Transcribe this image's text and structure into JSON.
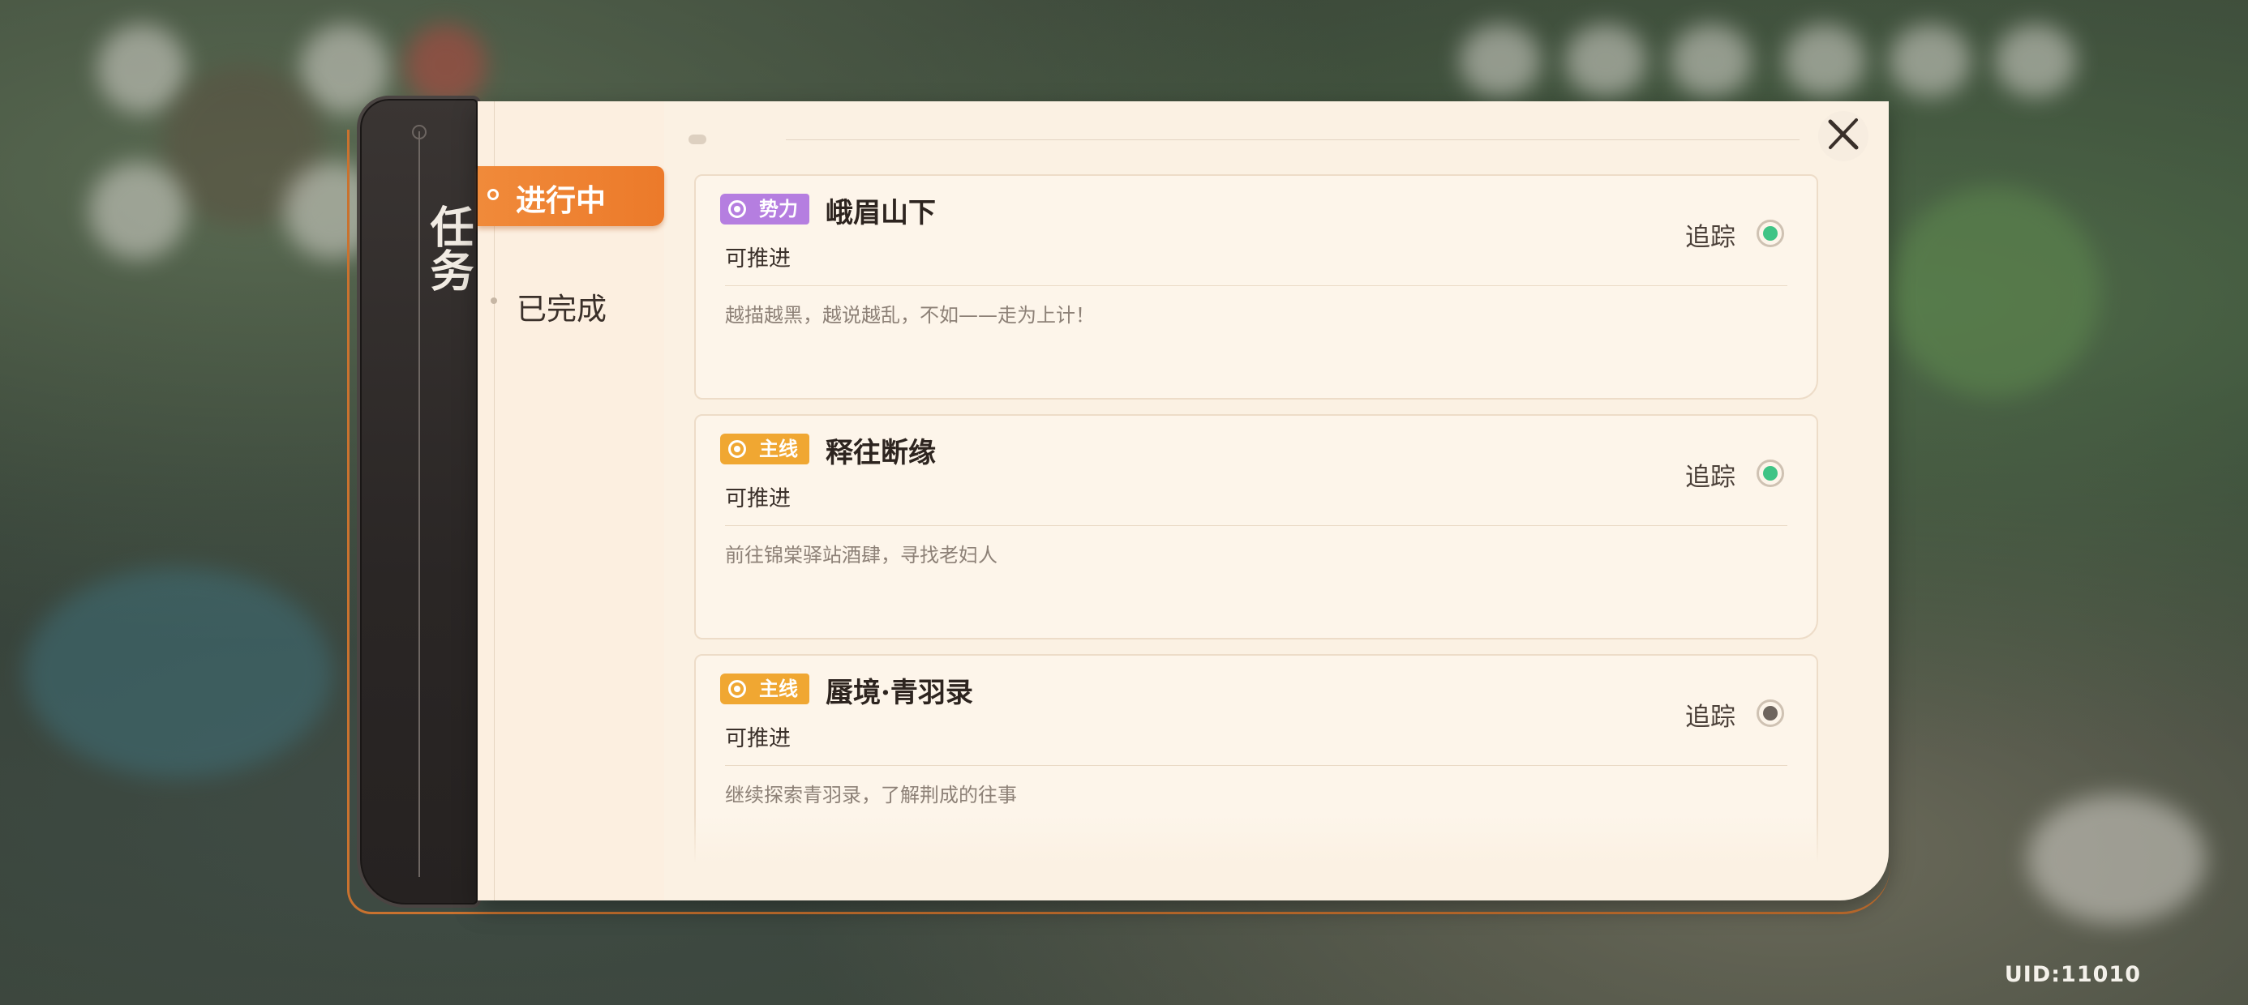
{
  "background": {
    "uid": "UID:11010"
  },
  "sidebar": {
    "title": "任务"
  },
  "tabs": [
    {
      "label": "进行中",
      "active": true
    },
    {
      "label": "已完成",
      "active": false
    }
  ],
  "quests": [
    {
      "tag": "势力",
      "tag_color": "#b57ee0",
      "title": "峨眉山下",
      "status": "可推进",
      "description": "越描越黑，越说越乱，不如——走为上计！",
      "track_label": "追踪",
      "tracked": true,
      "track_color": "#3fc485"
    },
    {
      "tag": "主线",
      "tag_color": "#f0a732",
      "title": "释往断缘",
      "status": "可推进",
      "description": "前往锦棠驿站酒肆，寻找老妇人",
      "track_label": "追踪",
      "tracked": true,
      "track_color": "#3fc485"
    },
    {
      "tag": "主线",
      "tag_color": "#f0a732",
      "title": "蜃境·青羽录",
      "status": "可推进",
      "description": "继续探索青羽录，了解荆成的往事",
      "track_label": "追踪",
      "tracked": false,
      "track_color": "#6e655e"
    }
  ],
  "icons": {
    "close": "close-icon"
  }
}
